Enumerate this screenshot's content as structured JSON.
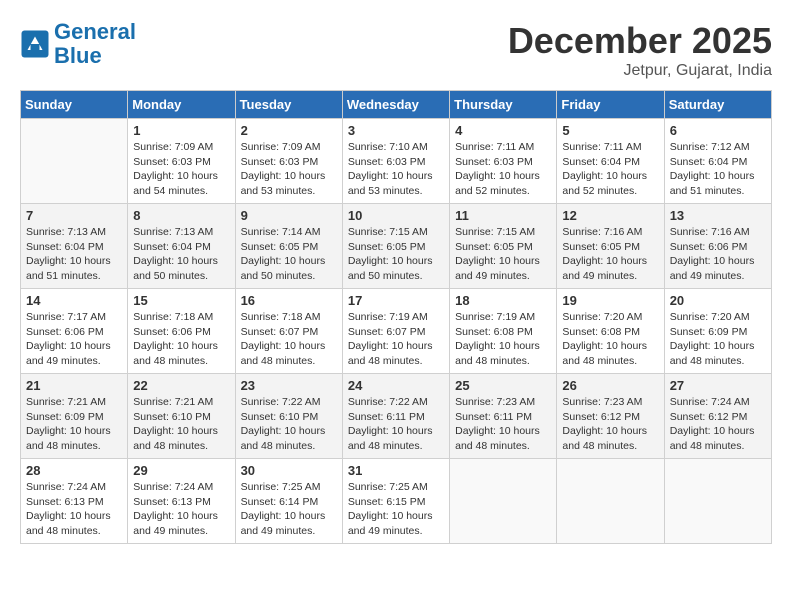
{
  "header": {
    "logo_line1": "General",
    "logo_line2": "Blue",
    "month": "December 2025",
    "location": "Jetpur, Gujarat, India"
  },
  "weekdays": [
    "Sunday",
    "Monday",
    "Tuesday",
    "Wednesday",
    "Thursday",
    "Friday",
    "Saturday"
  ],
  "weeks": [
    [
      {
        "day": "",
        "info": ""
      },
      {
        "day": "1",
        "info": "Sunrise: 7:09 AM\nSunset: 6:03 PM\nDaylight: 10 hours\nand 54 minutes."
      },
      {
        "day": "2",
        "info": "Sunrise: 7:09 AM\nSunset: 6:03 PM\nDaylight: 10 hours\nand 53 minutes."
      },
      {
        "day": "3",
        "info": "Sunrise: 7:10 AM\nSunset: 6:03 PM\nDaylight: 10 hours\nand 53 minutes."
      },
      {
        "day": "4",
        "info": "Sunrise: 7:11 AM\nSunset: 6:03 PM\nDaylight: 10 hours\nand 52 minutes."
      },
      {
        "day": "5",
        "info": "Sunrise: 7:11 AM\nSunset: 6:04 PM\nDaylight: 10 hours\nand 52 minutes."
      },
      {
        "day": "6",
        "info": "Sunrise: 7:12 AM\nSunset: 6:04 PM\nDaylight: 10 hours\nand 51 minutes."
      }
    ],
    [
      {
        "day": "7",
        "info": "Sunrise: 7:13 AM\nSunset: 6:04 PM\nDaylight: 10 hours\nand 51 minutes."
      },
      {
        "day": "8",
        "info": "Sunrise: 7:13 AM\nSunset: 6:04 PM\nDaylight: 10 hours\nand 50 minutes."
      },
      {
        "day": "9",
        "info": "Sunrise: 7:14 AM\nSunset: 6:05 PM\nDaylight: 10 hours\nand 50 minutes."
      },
      {
        "day": "10",
        "info": "Sunrise: 7:15 AM\nSunset: 6:05 PM\nDaylight: 10 hours\nand 50 minutes."
      },
      {
        "day": "11",
        "info": "Sunrise: 7:15 AM\nSunset: 6:05 PM\nDaylight: 10 hours\nand 49 minutes."
      },
      {
        "day": "12",
        "info": "Sunrise: 7:16 AM\nSunset: 6:05 PM\nDaylight: 10 hours\nand 49 minutes."
      },
      {
        "day": "13",
        "info": "Sunrise: 7:16 AM\nSunset: 6:06 PM\nDaylight: 10 hours\nand 49 minutes."
      }
    ],
    [
      {
        "day": "14",
        "info": "Sunrise: 7:17 AM\nSunset: 6:06 PM\nDaylight: 10 hours\nand 49 minutes."
      },
      {
        "day": "15",
        "info": "Sunrise: 7:18 AM\nSunset: 6:06 PM\nDaylight: 10 hours\nand 48 minutes."
      },
      {
        "day": "16",
        "info": "Sunrise: 7:18 AM\nSunset: 6:07 PM\nDaylight: 10 hours\nand 48 minutes."
      },
      {
        "day": "17",
        "info": "Sunrise: 7:19 AM\nSunset: 6:07 PM\nDaylight: 10 hours\nand 48 minutes."
      },
      {
        "day": "18",
        "info": "Sunrise: 7:19 AM\nSunset: 6:08 PM\nDaylight: 10 hours\nand 48 minutes."
      },
      {
        "day": "19",
        "info": "Sunrise: 7:20 AM\nSunset: 6:08 PM\nDaylight: 10 hours\nand 48 minutes."
      },
      {
        "day": "20",
        "info": "Sunrise: 7:20 AM\nSunset: 6:09 PM\nDaylight: 10 hours\nand 48 minutes."
      }
    ],
    [
      {
        "day": "21",
        "info": "Sunrise: 7:21 AM\nSunset: 6:09 PM\nDaylight: 10 hours\nand 48 minutes."
      },
      {
        "day": "22",
        "info": "Sunrise: 7:21 AM\nSunset: 6:10 PM\nDaylight: 10 hours\nand 48 minutes."
      },
      {
        "day": "23",
        "info": "Sunrise: 7:22 AM\nSunset: 6:10 PM\nDaylight: 10 hours\nand 48 minutes."
      },
      {
        "day": "24",
        "info": "Sunrise: 7:22 AM\nSunset: 6:11 PM\nDaylight: 10 hours\nand 48 minutes."
      },
      {
        "day": "25",
        "info": "Sunrise: 7:23 AM\nSunset: 6:11 PM\nDaylight: 10 hours\nand 48 minutes."
      },
      {
        "day": "26",
        "info": "Sunrise: 7:23 AM\nSunset: 6:12 PM\nDaylight: 10 hours\nand 48 minutes."
      },
      {
        "day": "27",
        "info": "Sunrise: 7:24 AM\nSunset: 6:12 PM\nDaylight: 10 hours\nand 48 minutes."
      }
    ],
    [
      {
        "day": "28",
        "info": "Sunrise: 7:24 AM\nSunset: 6:13 PM\nDaylight: 10 hours\nand 48 minutes."
      },
      {
        "day": "29",
        "info": "Sunrise: 7:24 AM\nSunset: 6:13 PM\nDaylight: 10 hours\nand 49 minutes."
      },
      {
        "day": "30",
        "info": "Sunrise: 7:25 AM\nSunset: 6:14 PM\nDaylight: 10 hours\nand 49 minutes."
      },
      {
        "day": "31",
        "info": "Sunrise: 7:25 AM\nSunset: 6:15 PM\nDaylight: 10 hours\nand 49 minutes."
      },
      {
        "day": "",
        "info": ""
      },
      {
        "day": "",
        "info": ""
      },
      {
        "day": "",
        "info": ""
      }
    ]
  ]
}
